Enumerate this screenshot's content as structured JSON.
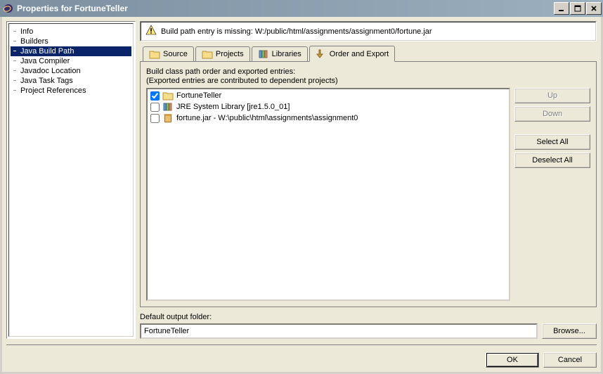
{
  "window": {
    "title": "Properties for FortuneTeller"
  },
  "nav": {
    "items": [
      {
        "label": "Info"
      },
      {
        "label": "Builders"
      },
      {
        "label": "Java Build Path"
      },
      {
        "label": "Java Compiler"
      },
      {
        "label": "Javadoc Location"
      },
      {
        "label": "Java Task Tags"
      },
      {
        "label": "Project References"
      }
    ],
    "selected_index": 2
  },
  "warning": {
    "text": "Build path entry is missing: W:/public/html/assignments/assignment0/fortune.jar"
  },
  "tabs": [
    {
      "label": "Source",
      "icon": "folder-source-icon"
    },
    {
      "label": "Projects",
      "icon": "folder-project-icon"
    },
    {
      "label": "Libraries",
      "icon": "library-icon"
    },
    {
      "label": "Order and Export",
      "icon": "order-export-icon"
    }
  ],
  "active_tab_index": 3,
  "order_export": {
    "header": "Build class path order and exported entries:",
    "subheader": "(Exported entries are contributed to dependent projects)",
    "entries": [
      {
        "checked": true,
        "icon": "folder-icon",
        "label": "FortuneTeller"
      },
      {
        "checked": false,
        "icon": "library-icon",
        "label": "JRE System Library [jre1.5.0_01]"
      },
      {
        "checked": false,
        "icon": "jar-icon",
        "label": "fortune.jar - W:\\public\\html\\assignments\\assignment0"
      }
    ]
  },
  "side_buttons": {
    "up": "Up",
    "down": "Down",
    "select_all": "Select All",
    "deselect_all": "Deselect All"
  },
  "output": {
    "label": "Default output folder:",
    "value": "FortuneTeller",
    "browse": "Browse..."
  },
  "footer": {
    "ok": "OK",
    "cancel": "Cancel"
  }
}
